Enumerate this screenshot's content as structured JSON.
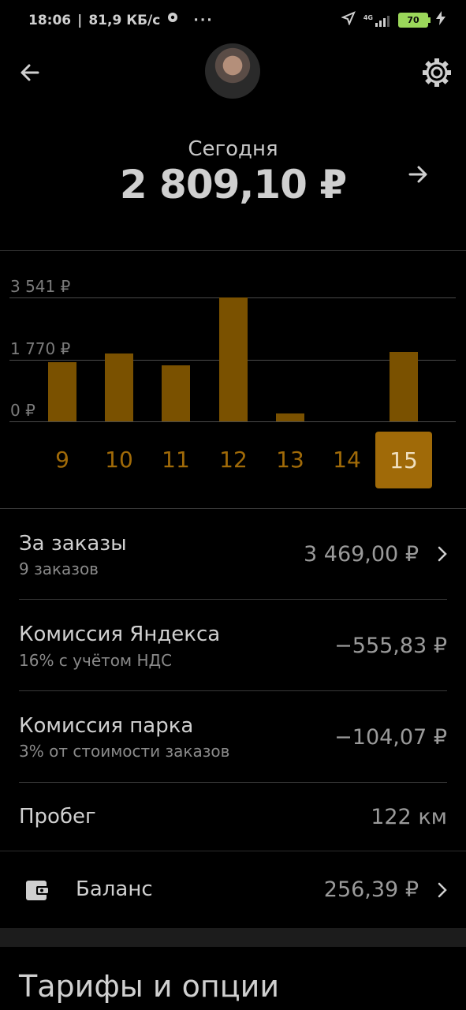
{
  "status_bar": {
    "time": "18:06",
    "network_speed": "81,9 КБ/с",
    "network_type": "4G",
    "battery": "70"
  },
  "header": {
    "back_icon": "arrow-left-icon",
    "settings_icon": "gear-icon",
    "today_label": "Сегодня",
    "today_amount": "2 809,10 ₽",
    "details_icon": "arrow-right-icon"
  },
  "chart_data": {
    "type": "bar",
    "categories": [
      "9",
      "10",
      "11",
      "12",
      "13",
      "14",
      "15"
    ],
    "values": [
      1700,
      1950,
      1610,
      3541,
      220,
      0,
      1980
    ],
    "ylim": [
      0,
      3541
    ],
    "y_tick_labels": [
      "3 541 ₽",
      "1 770 ₽",
      "0 ₽"
    ],
    "selected_category": "15",
    "bar_color": "#7a5100",
    "selected_color": "#a06a08",
    "grid": true
  },
  "rows": [
    {
      "title": "За заказы",
      "subtitle": "9 заказов",
      "value": "3 469,00 ₽",
      "chevron": true
    },
    {
      "title": "Комиссия Яндекса",
      "subtitle": "16% с учётом НДС",
      "value": "−555,83 ₽",
      "chevron": false
    },
    {
      "title": "Комиссия парка",
      "subtitle": "3% от стоимости заказов",
      "value": "−104,07 ₽",
      "chevron": false
    },
    {
      "title": "Пробег",
      "subtitle": "",
      "value": "122 км",
      "chevron": false
    }
  ],
  "balance": {
    "icon": "wallet-icon",
    "label": "Баланс",
    "value": "256,39 ₽"
  },
  "section": {
    "title": "Тарифы и опции"
  }
}
